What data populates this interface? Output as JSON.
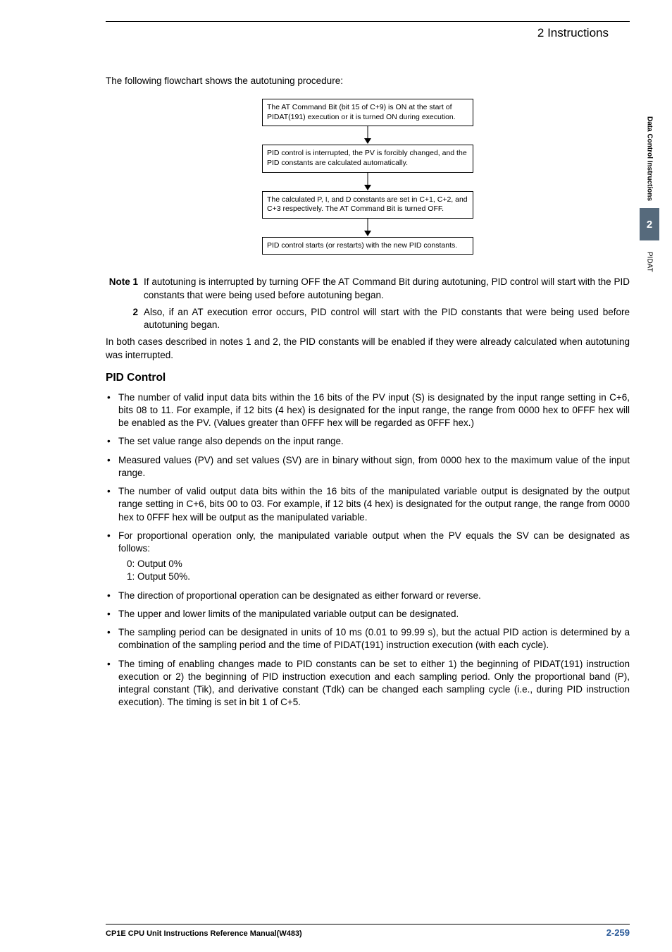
{
  "header": {
    "chapter": "2   Instructions"
  },
  "intro": "The following flowchart shows the autotuning procedure:",
  "flow": {
    "b1": "The AT Command Bit (bit 15 of C+9) is ON at the start of PIDAT(191) execution or it is turned ON during execution.",
    "b2": "PID control is interrupted, the PV is forcibly changed, and the PID constants are calculated automatically.",
    "b3": "The calculated P, I, and D constants are set in C+1, C+2, and C+3 respectively. The AT Command Bit is turned OFF.",
    "b4": "PID control starts (or restarts) with the new PID constants."
  },
  "notes": {
    "label1": "Note 1",
    "n1": "If autotuning is interrupted by turning OFF the AT Command Bit during autotuning, PID control will start with the PID constants that were being used before autotuning began.",
    "label2": "2",
    "n2": "Also, if an AT execution error occurs, PID control will start with the PID constants that were being used before autotuning began."
  },
  "para1": "In both cases described in notes 1 and 2, the PID constants will be enabled if they were already calculated when autotuning was interrupted.",
  "sectionTitle": "PID Control",
  "bullets": {
    "b1": "The number of valid input data bits within the 16 bits of the PV input (S) is designated by the input range setting in C+6, bits 08 to 11. For example, if 12 bits (4 hex) is designated for the input range, the range from 0000 hex to 0FFF hex will be enabled as the PV. (Values greater than 0FFF hex will be regarded as 0FFF hex.)",
    "b2": "The set value range also depends on the input range.",
    "b3": "Measured values (PV) and set values (SV) are in binary without sign, from 0000 hex to the maximum value of the input range.",
    "b4": "The number of valid output data bits within the 16 bits of the manipulated variable output is designated by the output range setting in C+6, bits 00 to 03. For example, if 12 bits (4 hex) is designated for the output range, the range from 0000 hex to 0FFF hex will be output as the manipulated variable.",
    "b5": "For proportional operation only, the manipulated variable output when the PV equals the SV can be designated as follows:",
    "b5a": "0: Output 0%",
    "b5b": "1: Output 50%.",
    "b6": "The direction of proportional operation can be designated as either forward or reverse.",
    "b7": "The upper and lower limits of the manipulated variable output can be designated.",
    "b8": "The sampling period can be designated in units of 10 ms (0.01 to 99.99 s), but the actual PID action is determined by a combination of the sampling period and the time of PIDAT(191) instruction execution (with each cycle).",
    "b9": "The timing of enabling changes made to PID constants can be set to either 1) the beginning of PIDAT(191) instruction execution or 2) the beginning of PID instruction execution and each sampling period. Only the proportional band (P), integral constant (Tik), and derivative constant (Tdk) can be changed each sampling cycle (i.e., during PID instruction execution). The timing is set in bit 1 of C+5."
  },
  "footer": {
    "left": "CP1E CPU Unit Instructions Reference Manual(W483)",
    "right": "2-259"
  },
  "side": {
    "category": "Data Control Instructions",
    "num": "2",
    "name": "PIDAT"
  }
}
